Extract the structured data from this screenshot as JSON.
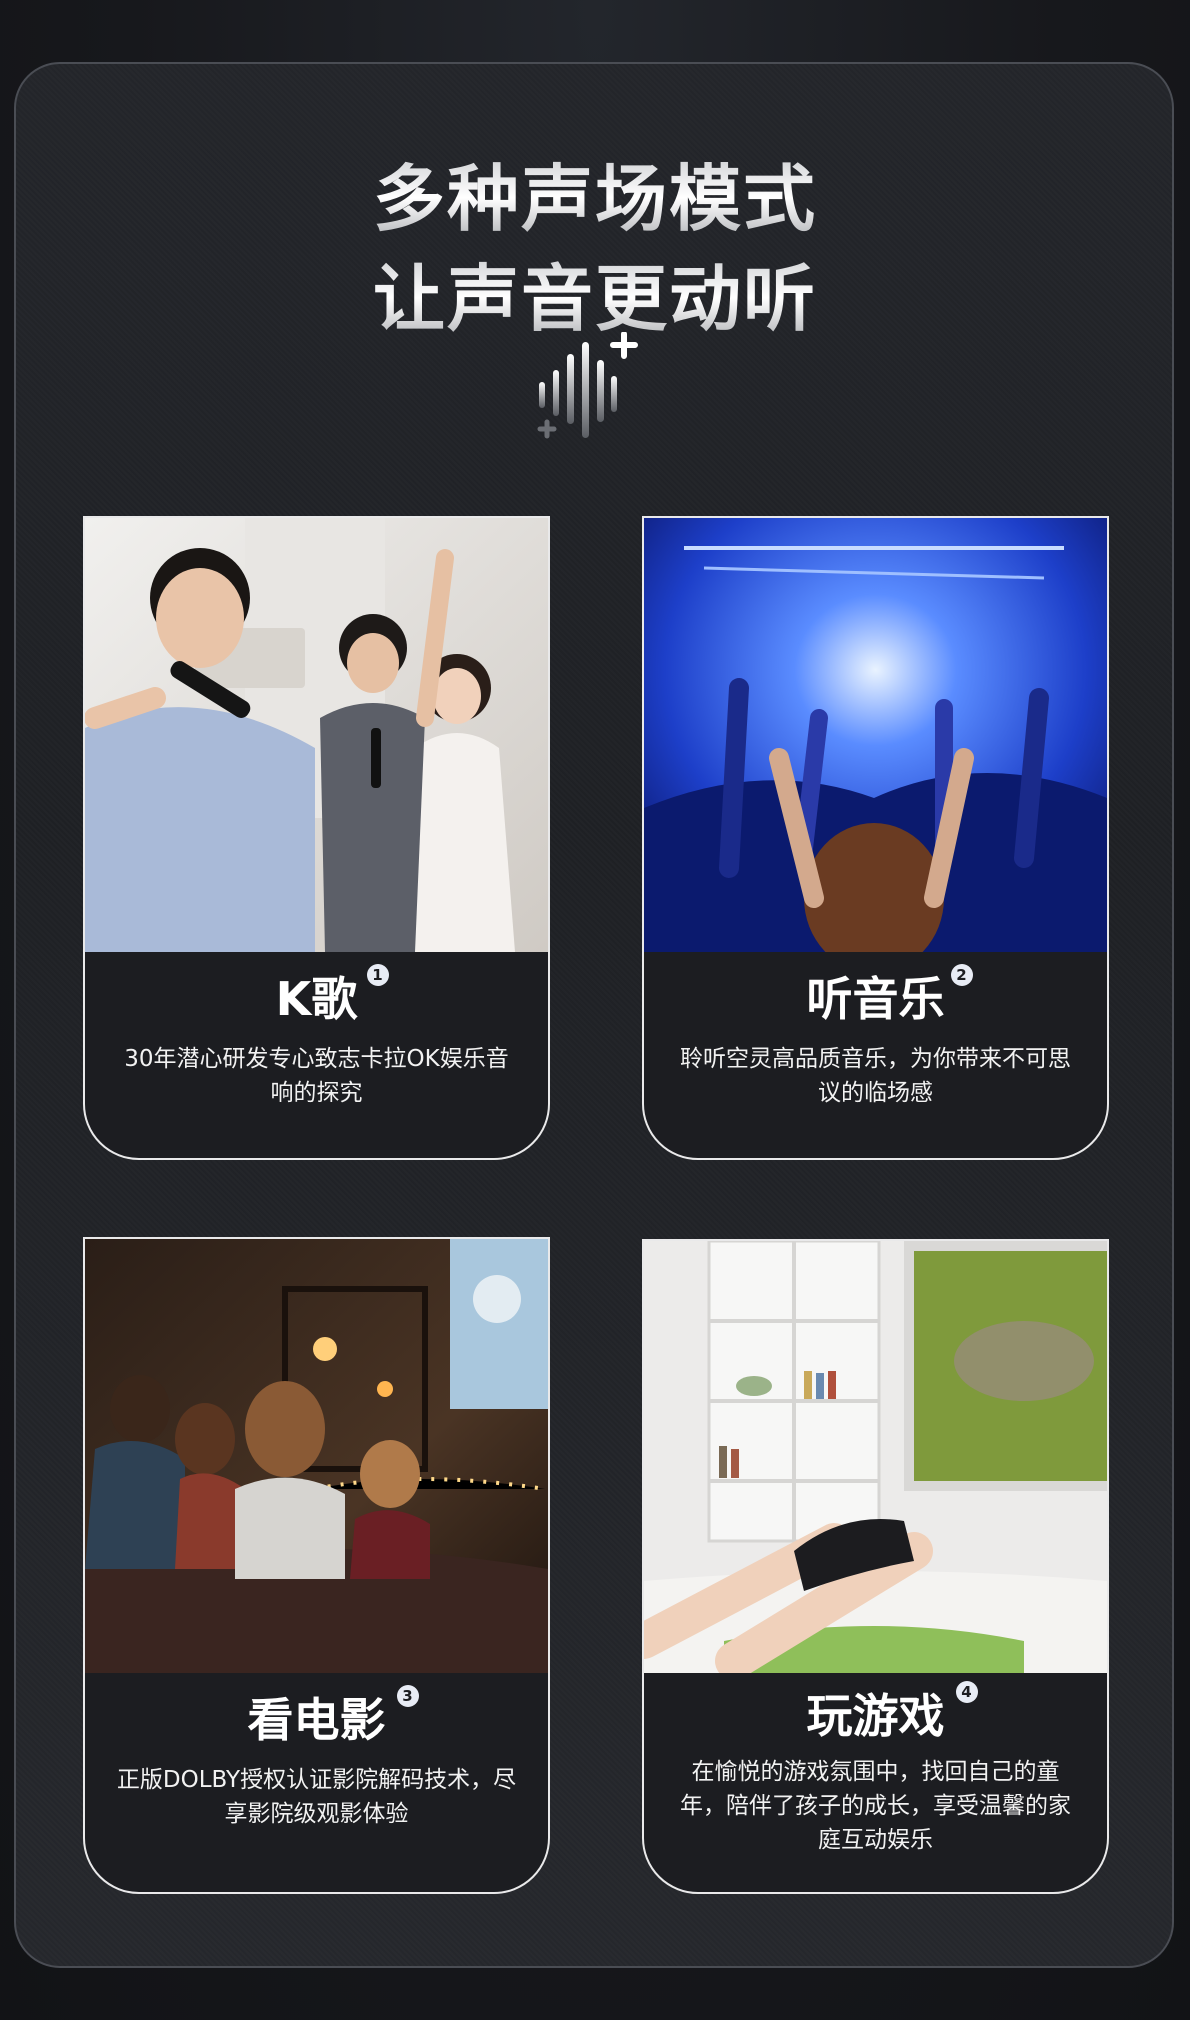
{
  "headline": {
    "line1": "多种声场模式",
    "line2": "让声音更动听"
  },
  "icons": {
    "sound_wave": "sound-wave-sparkle-icon"
  },
  "colors": {
    "page_background": "#141519",
    "card_background": "#1c1d21",
    "card_border": "#e9e9ea",
    "badge_background": "#e8ecf5",
    "text": "#ffffff"
  },
  "cards": [
    {
      "title": "K歌",
      "badge": "1",
      "description": "30年潜心研发专心致志卡拉OK娱乐音响的探究",
      "image": "karaoke-photo"
    },
    {
      "title": "听音乐",
      "badge": "2",
      "description": "聆听空灵高品质音乐，为你带来不可思议的临场感",
      "image": "concert-photo"
    },
    {
      "title": "看电影",
      "badge": "3",
      "description": "正版DOLBY授权认证影院解码技术，尽享影院级观影体验",
      "image": "family-movie-photo"
    },
    {
      "title": "玩游戏",
      "badge": "4",
      "description": "在愉悦的游戏氛围中，找回自己的童年，陪伴了孩子的成长，享受温馨的家庭互动娱乐",
      "image": "gaming-photo"
    }
  ]
}
